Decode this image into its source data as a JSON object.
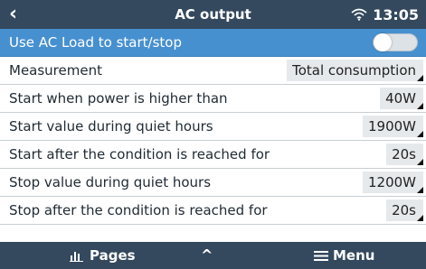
{
  "header": {
    "back_icon": "back-chevron-icon",
    "title": "AC output",
    "time": "13:05",
    "wifi_icon": "wifi-icon"
  },
  "settings": [
    {
      "label": "Use AC Load to start/stop",
      "type": "toggle",
      "state": "off"
    },
    {
      "label": "Measurement",
      "value": "Total consumption"
    },
    {
      "label": "Start when power is higher than",
      "value": "40W"
    },
    {
      "label": "Start value during quiet hours",
      "value": "1900W"
    },
    {
      "label": "Start after the condition is reached for",
      "value": "20s"
    },
    {
      "label": "Stop value during quiet hours",
      "value": "1200W"
    },
    {
      "label": "Stop after the condition is reached for",
      "value": "20s"
    }
  ],
  "footer": {
    "pages_label": "Pages",
    "pages_icon": "bar-chart-icon",
    "up_label": "^",
    "menu_label": "Menu",
    "menu_icon": "hamburger-icon"
  },
  "colors": {
    "header_bg": "#34495e",
    "selected_row_bg": "#4790d0",
    "value_box_bg": "#e6e9ec"
  }
}
